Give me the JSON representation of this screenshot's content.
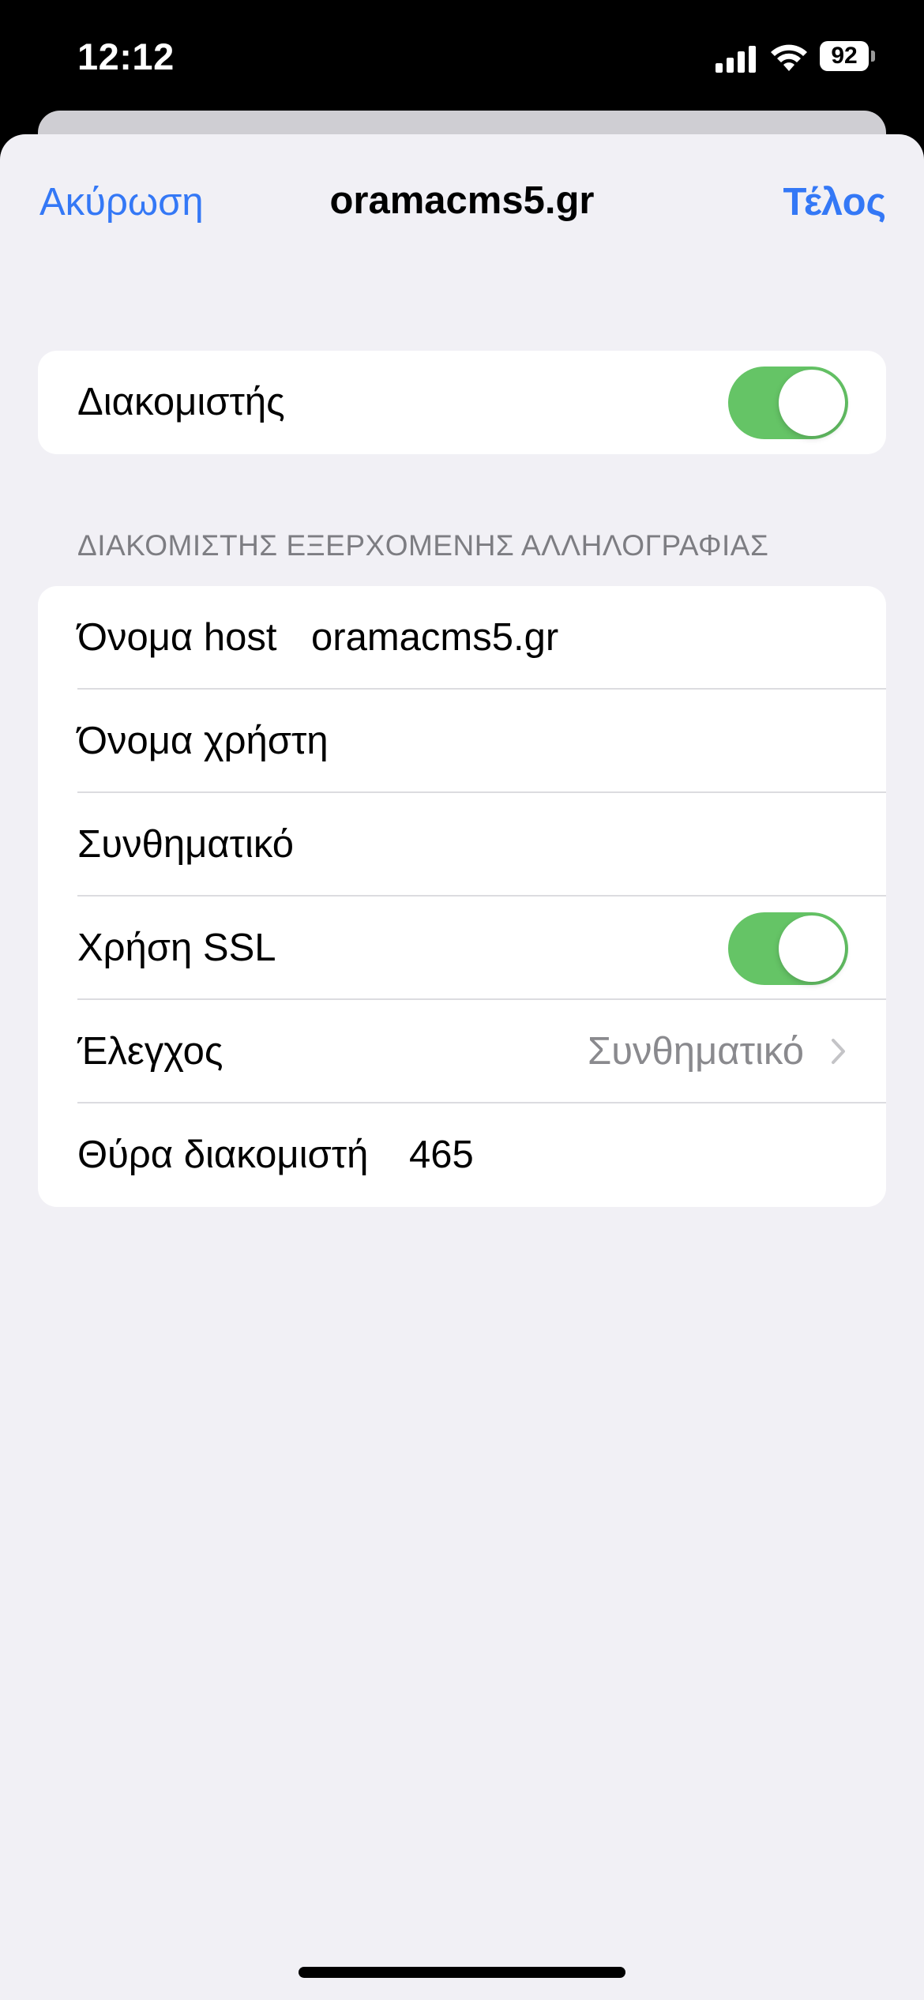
{
  "status_bar": {
    "time": "12:12",
    "battery": "92",
    "icons": [
      "cellular-signal-icon",
      "wifi-icon",
      "battery-icon"
    ]
  },
  "nav": {
    "cancel_label": "Ακύρωση",
    "title": "oramacms5.gr",
    "done_label": "Τέλος"
  },
  "server_toggle": {
    "label": "Διακομιστής",
    "on": true
  },
  "outgoing": {
    "section_header": "ΔΙΑΚΟΜΙΣΤΗΣ ΕΞΕΡΧΟΜΕΝΗΣ ΑΛΛΗΛΟΓΡΑΦΙΑΣ",
    "host_label": "Όνομα host",
    "host_value": "oramacms5.gr",
    "username_label": "Όνομα χρήστη",
    "username_value": "",
    "password_label": "Συνθηματικό",
    "password_value": "",
    "ssl_label": "Χρήση SSL",
    "ssl_on": true,
    "auth_label": "Έλεγχος",
    "auth_value": "Συνθηματικό",
    "port_label": "Θύρα διακομιστή",
    "port_value": "465"
  },
  "colors": {
    "accent": "#3478f6",
    "toggle_on": "#65c466",
    "background": "#f1f0f5",
    "secondary_text": "#8a8a8e"
  }
}
